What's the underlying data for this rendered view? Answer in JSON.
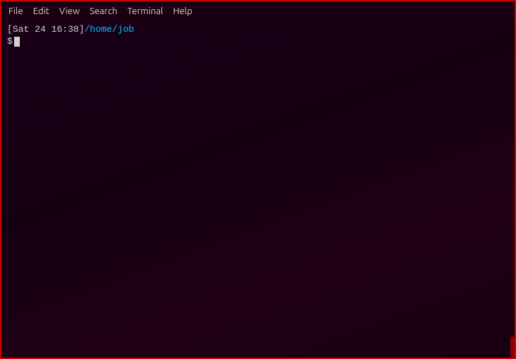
{
  "menubar": {
    "items": [
      {
        "label": "File",
        "id": "file"
      },
      {
        "label": "Edit",
        "id": "edit"
      },
      {
        "label": "View",
        "id": "view"
      },
      {
        "label": "Search",
        "id": "search"
      },
      {
        "label": "Terminal",
        "id": "terminal"
      },
      {
        "label": "Help",
        "id": "help"
      }
    ]
  },
  "terminal": {
    "prompt_time": "[Sat 24 16:38]",
    "prompt_path": " /home/job",
    "prompt_dollar": "$ "
  }
}
